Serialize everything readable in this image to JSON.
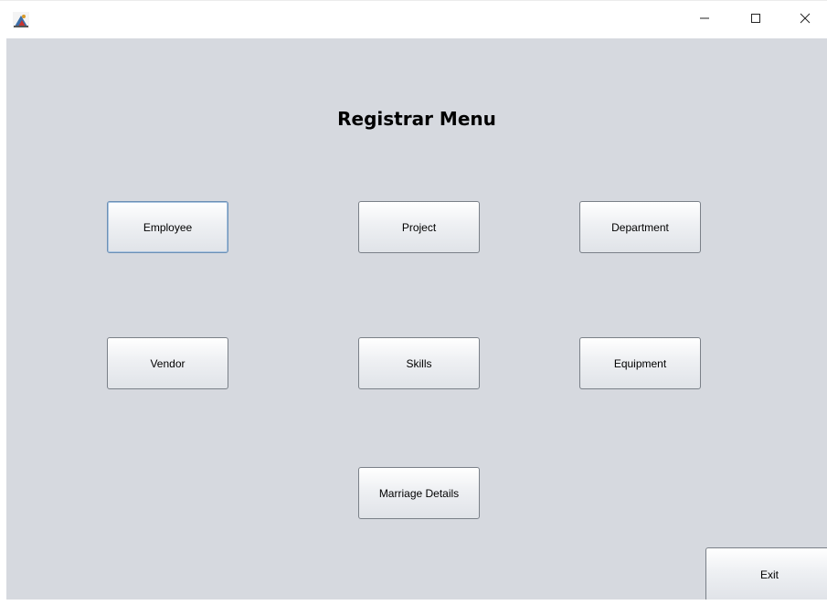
{
  "window": {
    "controls": {
      "minimize": "minimize-icon",
      "maximize": "maximize-icon",
      "close": "close-icon"
    }
  },
  "main": {
    "title": "Registrar Menu",
    "buttons": {
      "employee": "Employee",
      "project": "Project",
      "department": "Department",
      "vendor": "Vendor",
      "skills": "Skills",
      "equipment": "Equipment",
      "marriage_details": "Marriage Details"
    },
    "exit": "Exit"
  },
  "colors": {
    "background": "#d6d9df",
    "focus_border": "#6b8fb5"
  }
}
